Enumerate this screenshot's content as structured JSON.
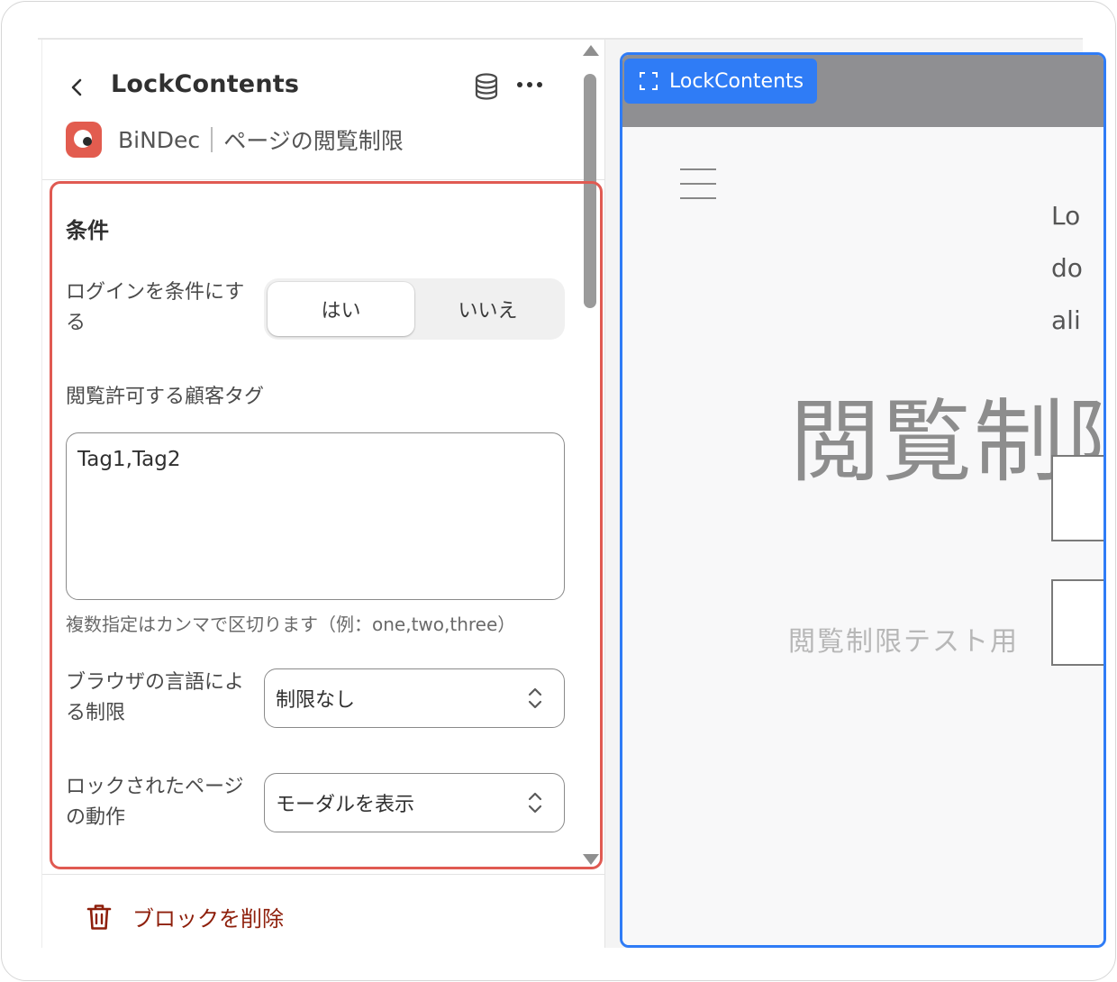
{
  "header": {
    "title": "LockContents",
    "app_name": "BiNDec",
    "app_description": "ページの閲覧制限"
  },
  "section": {
    "title": "条件"
  },
  "login_condition": {
    "label": "ログインを条件にする",
    "options": [
      "はい",
      "いいえ"
    ],
    "selected": "はい"
  },
  "customer_tags": {
    "label": "閲覧許可する顧客タグ",
    "value": "Tag1,Tag2",
    "help": "複数指定はカンマで区切ります（例：one,two,three）"
  },
  "browser_language": {
    "label": "ブラウザの言語による制限",
    "value": "制限なし"
  },
  "locked_page_behavior": {
    "label": "ロックされたページの動作",
    "value": "モーダルを表示"
  },
  "footer": {
    "delete_label": "ブロックを削除"
  },
  "preview": {
    "tab_label": "LockContents",
    "text_lines": [
      "Lo",
      "do",
      "ali"
    ],
    "heading": "閲覧制限",
    "subtitle": "閲覧制限テスト用"
  },
  "icons": {
    "back": "chevron-left-icon",
    "database": "database-icon",
    "more": "more-horizontal-icon",
    "select_chevron": "chevron-up-down-icon",
    "trash": "trash-icon",
    "frame": "frame-icon",
    "menu": "hamburger-icon"
  },
  "colors": {
    "highlight": "#e05a52",
    "accent_blue": "#2f7cf6",
    "danger": "#8e1f0b",
    "app_logo": "#e25c4f"
  }
}
